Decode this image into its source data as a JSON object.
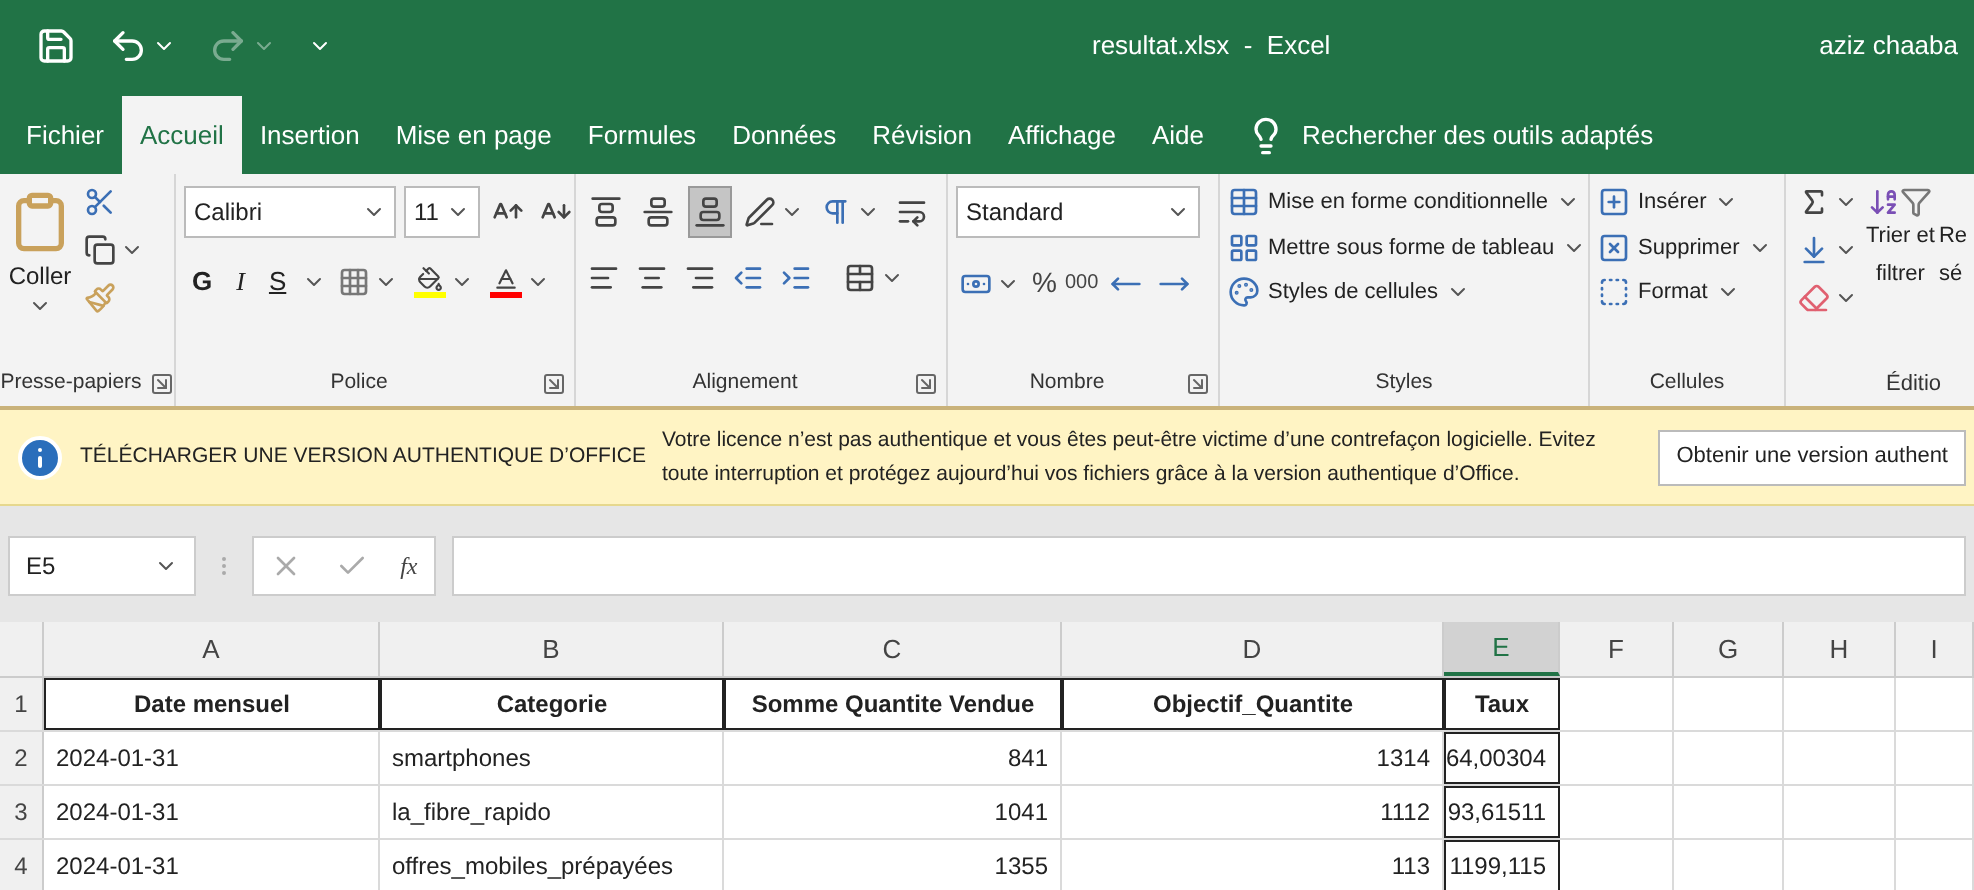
{
  "quick_access": {
    "redo": {
      "disabled": true
    }
  },
  "window": {
    "title": "resultat.xlsx  -  Excel",
    "user": "aziz chaaba"
  },
  "tabs": [
    {
      "label": "Fichier",
      "selected": false
    },
    {
      "label": "Accueil",
      "selected": true
    },
    {
      "label": "Insertion",
      "selected": false
    },
    {
      "label": "Mise en page",
      "selected": false
    },
    {
      "label": "Formules",
      "selected": false
    },
    {
      "label": "Données",
      "selected": false
    },
    {
      "label": "Révision",
      "selected": false
    },
    {
      "label": "Affichage",
      "selected": false
    },
    {
      "label": "Aide",
      "selected": false
    }
  ],
  "search": {
    "placeholder": "Rechercher des outils adaptés"
  },
  "ribbon": {
    "clipboard": {
      "label": "Presse-papiers",
      "paste": "Coller"
    },
    "font": {
      "label": "Police",
      "name": "Calibri",
      "size": "11",
      "bold": "G",
      "italic": "I",
      "underline": "S"
    },
    "alignment": {
      "label": "Alignement",
      "vertical": [
        {
          "selected": false
        },
        {
          "selected": false
        },
        {
          "selected": true
        }
      ]
    },
    "number": {
      "label": "Nombre",
      "format": "Standard",
      "percent": "%",
      "thousands": "000"
    },
    "styles": {
      "label": "Styles",
      "items": [
        "Mise en forme conditionnelle",
        "Mettre sous forme de tableau",
        "Styles de cellules"
      ]
    },
    "cells": {
      "label": "Cellules",
      "items": [
        "Insérer",
        "Supprimer",
        "Format"
      ]
    },
    "editing": {
      "label": "Éditio",
      "sort_line_1": "Trier et",
      "sort_line_2": "filtrer",
      "find_line_1": "Re",
      "find_line_2": "sé"
    }
  },
  "banner": {
    "title": "TÉLÉCHARGER UNE VERSION AUTHENTIQUE D’OFFICE",
    "message": "Votre licence n’est pas authentique et vous êtes peut-être victime d’une contrefaçon logicielle. Evitez toute interruption et protégez aujourd’hui vos fichiers grâce à la version authentique d’Office.",
    "button": "Obtenir une version authent"
  },
  "formula_bar": {
    "name_box": "E5",
    "function_label": "fx"
  },
  "sheet": {
    "columns": [
      {
        "letter": "A",
        "kind": "text",
        "selected": false
      },
      {
        "letter": "B",
        "kind": "text",
        "selected": false
      },
      {
        "letter": "C",
        "kind": "number",
        "selected": false
      },
      {
        "letter": "D",
        "kind": "number",
        "selected": false
      },
      {
        "letter": "E",
        "kind": "number",
        "selected": true
      },
      {
        "letter": "F",
        "kind": "empty",
        "selected": false
      },
      {
        "letter": "G",
        "kind": "empty",
        "selected": false
      },
      {
        "letter": "H",
        "kind": "empty",
        "selected": false
      },
      {
        "letter": "I",
        "kind": "empty",
        "selected": false
      }
    ],
    "rows": [
      {
        "number": "1",
        "kind": "header",
        "cells": [
          "Date mensuel",
          "Categorie",
          "Somme Quantite Vendue",
          "Objectif_Quantite",
          "Taux"
        ]
      },
      {
        "number": "2",
        "kind": "data",
        "cells": [
          "2024-01-31",
          "smartphones",
          "841",
          "1314",
          "64,00304"
        ]
      },
      {
        "number": "3",
        "kind": "data",
        "cells": [
          "2024-01-31",
          "la_fibre_rapido",
          "1041",
          "1112",
          "93,61511"
        ]
      },
      {
        "number": "4",
        "kind": "data",
        "cells": [
          "2024-01-31",
          "offres_mobiles_prépayées",
          "1355",
          "113",
          "1199,115"
        ]
      }
    ]
  }
}
